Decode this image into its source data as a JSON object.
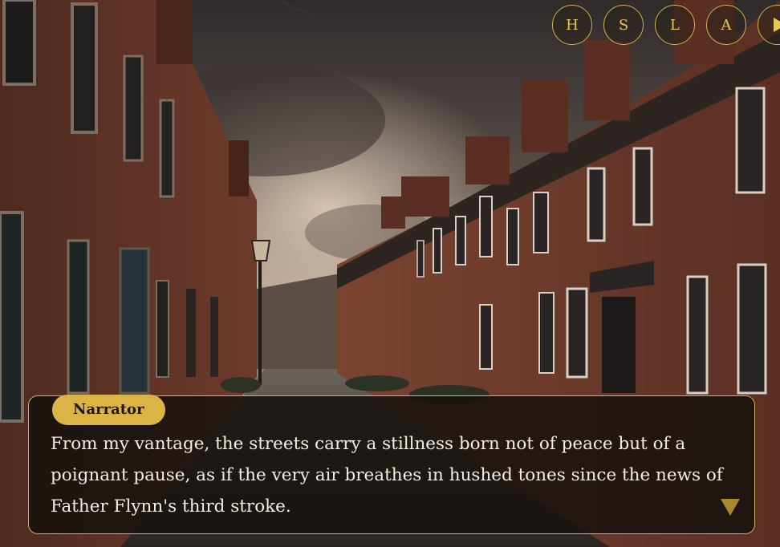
{
  "menu": {
    "history_label": "H",
    "save_label": "S",
    "load_label": "L",
    "auto_label": "A",
    "play_icon": "play-icon"
  },
  "dialogue": {
    "speaker": "Narrator",
    "text": "From my vantage, the streets carry a stillness born not of peace but of a poignant pause, as if the very air breathes in hushed tones since the news of Father Flynn's third stroke.",
    "advance_icon": "triangle-down-icon"
  },
  "colors": {
    "accent": "#d4b247",
    "speaker_badge": "#dcb445",
    "text": "#f4efe4"
  }
}
